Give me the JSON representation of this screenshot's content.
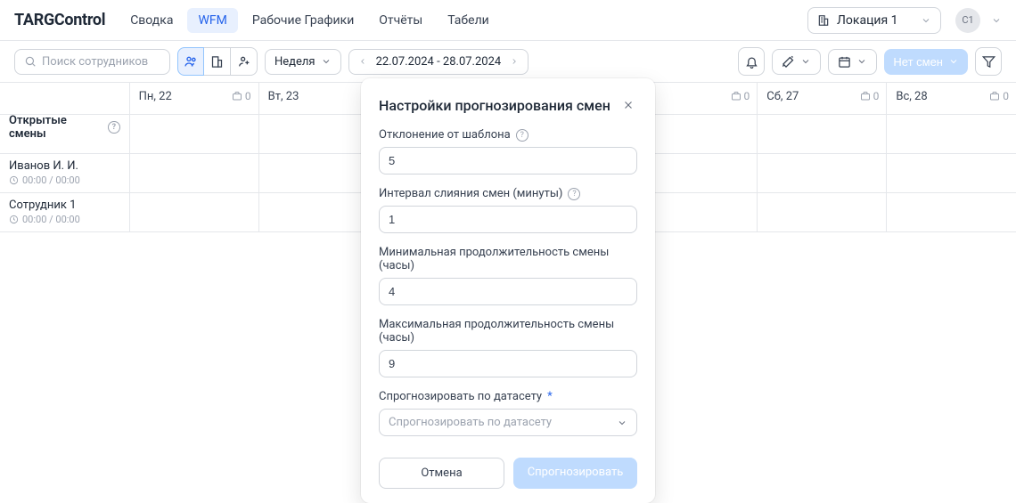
{
  "header": {
    "logo": "TARGControl",
    "nav": [
      "Сводка",
      "WFM",
      "Рабочие Графики",
      "Отчёты",
      "Табели"
    ],
    "active_nav_index": 1,
    "location": "Локация 1",
    "avatar": "С1"
  },
  "toolbar": {
    "search_placeholder": "Поиск сотрудников",
    "period": "Неделя",
    "date_range": "22.07.2024 - 28.07.2024",
    "no_shifts": "Нет смен"
  },
  "grid": {
    "days": [
      {
        "label": "Пн, 22",
        "count": "0"
      },
      {
        "label": "Вт, 23",
        "count": "0"
      },
      {
        "label": "",
        "count": ""
      },
      {
        "label": "",
        "count": "0"
      },
      {
        "label": "Сб, 27",
        "count": "0"
      },
      {
        "label": "Вс, 28",
        "count": "0"
      }
    ],
    "open_shifts": "Открытые смены",
    "employees": [
      {
        "name": "Иванов И. И.",
        "time": "00:00 / 00:00"
      },
      {
        "name": "Сотрудник 1",
        "time": "00:00 / 00:00"
      }
    ]
  },
  "modal": {
    "title": "Настройки прогнозирования смен",
    "fields": {
      "deviation": {
        "label": "Отклонение от шаблона",
        "value": "5"
      },
      "merge": {
        "label": "Интервал слияния смен (минуты)",
        "value": "1"
      },
      "minDur": {
        "label": "Минимальная продолжительность смены (часы)",
        "value": "4"
      },
      "maxDur": {
        "label": "Максимальная продолжительность смены (часы)",
        "value": "9"
      },
      "dataset": {
        "label": "Спрогнозировать по датасету",
        "placeholder": "Спрогнозировать по датасету"
      }
    },
    "cancel": "Отмена",
    "submit": "Спрогнозировать"
  }
}
